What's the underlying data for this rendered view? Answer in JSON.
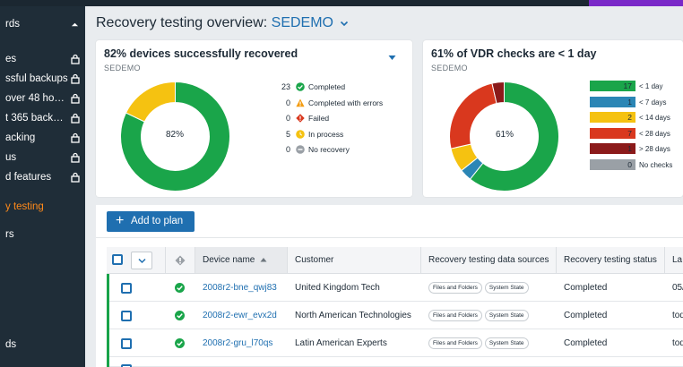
{
  "sidebar": {
    "items": [
      {
        "label": "rds",
        "lock": false,
        "caret": true,
        "active": false
      },
      {
        "label": "es",
        "lock": true,
        "caret": false,
        "active": false
      },
      {
        "label": "ssful backups",
        "lock": true,
        "caret": false,
        "active": false
      },
      {
        "label": "over 48 ho…",
        "lock": true,
        "caret": false,
        "active": false
      },
      {
        "label": "t 365 backu…",
        "lock": true,
        "caret": false,
        "active": false
      },
      {
        "label": "acking",
        "lock": true,
        "caret": false,
        "active": false
      },
      {
        "label": "us",
        "lock": true,
        "caret": false,
        "active": false
      },
      {
        "label": "d features",
        "lock": true,
        "caret": false,
        "active": false
      },
      {
        "label": "y testing",
        "lock": false,
        "caret": false,
        "active": true
      },
      {
        "label": "rs",
        "lock": false,
        "caret": false,
        "active": false
      },
      {
        "label": "ds",
        "lock": false,
        "caret": false,
        "active": false
      }
    ]
  },
  "header": {
    "title": "Recovery testing overview:",
    "tenant": "SEDEMO"
  },
  "recovered_card": {
    "title": "82% devices successfully recovered",
    "subtitle": "SEDEMO",
    "center_label": "82%",
    "legend": [
      {
        "count": "23",
        "label": "Completed",
        "color": "#1aa54a",
        "icon": "check-circle-icon"
      },
      {
        "count": "0",
        "label": "Completed with errors",
        "color": "#f39c12",
        "icon": "warning-icon"
      },
      {
        "count": "0",
        "label": "Failed",
        "color": "#d9381e",
        "icon": "error-icon"
      },
      {
        "count": "5",
        "label": "In process",
        "color": "#f5c211",
        "icon": "clock-icon"
      },
      {
        "count": "0",
        "label": "No recovery",
        "color": "#9aa0a6",
        "icon": "minus-circle-icon"
      }
    ]
  },
  "vdr_card": {
    "title": "61% of VDR checks are < 1 day",
    "subtitle": "SEDEMO",
    "center_label": "61%",
    "legend": [
      {
        "count": "17",
        "label": "< 1 day",
        "color": "#1aa54a"
      },
      {
        "count": "1",
        "label": "< 7 days",
        "color": "#2b86b5"
      },
      {
        "count": "2",
        "label": "< 14 days",
        "color": "#f5c211"
      },
      {
        "count": "7",
        "label": "< 28 days",
        "color": "#d9381e"
      },
      {
        "count": "1",
        "label": "> 28 days",
        "color": "#8b1a1a"
      },
      {
        "count": "0",
        "label": "No checks",
        "color": "#9aa0a6"
      }
    ]
  },
  "toolbar": {
    "add_to_plan": "Add to plan"
  },
  "table": {
    "columns": [
      "Device name",
      "Customer",
      "Recovery testing data sources",
      "Recovery testing status",
      "La"
    ],
    "rows": [
      {
        "device": "2008r2-bne_qwj83",
        "customer": "United Kingdom Tech",
        "sources": [
          "Files and Folders",
          "System State"
        ],
        "status": "Completed",
        "last": "05/"
      },
      {
        "device": "2008r2-ewr_evx2d",
        "customer": "North American Technologies",
        "sources": [
          "Files and Folders",
          "System State"
        ],
        "status": "Completed",
        "last": "tod"
      },
      {
        "device": "2008r2-gru_l70qs",
        "customer": "Latin American Experts",
        "sources": [
          "Files and Folders",
          "System State"
        ],
        "status": "Completed",
        "last": "tod"
      }
    ]
  },
  "colors": {
    "accent": "#1f6fb0",
    "success": "#1aa54a",
    "active_nav": "#ff8a1a"
  }
}
